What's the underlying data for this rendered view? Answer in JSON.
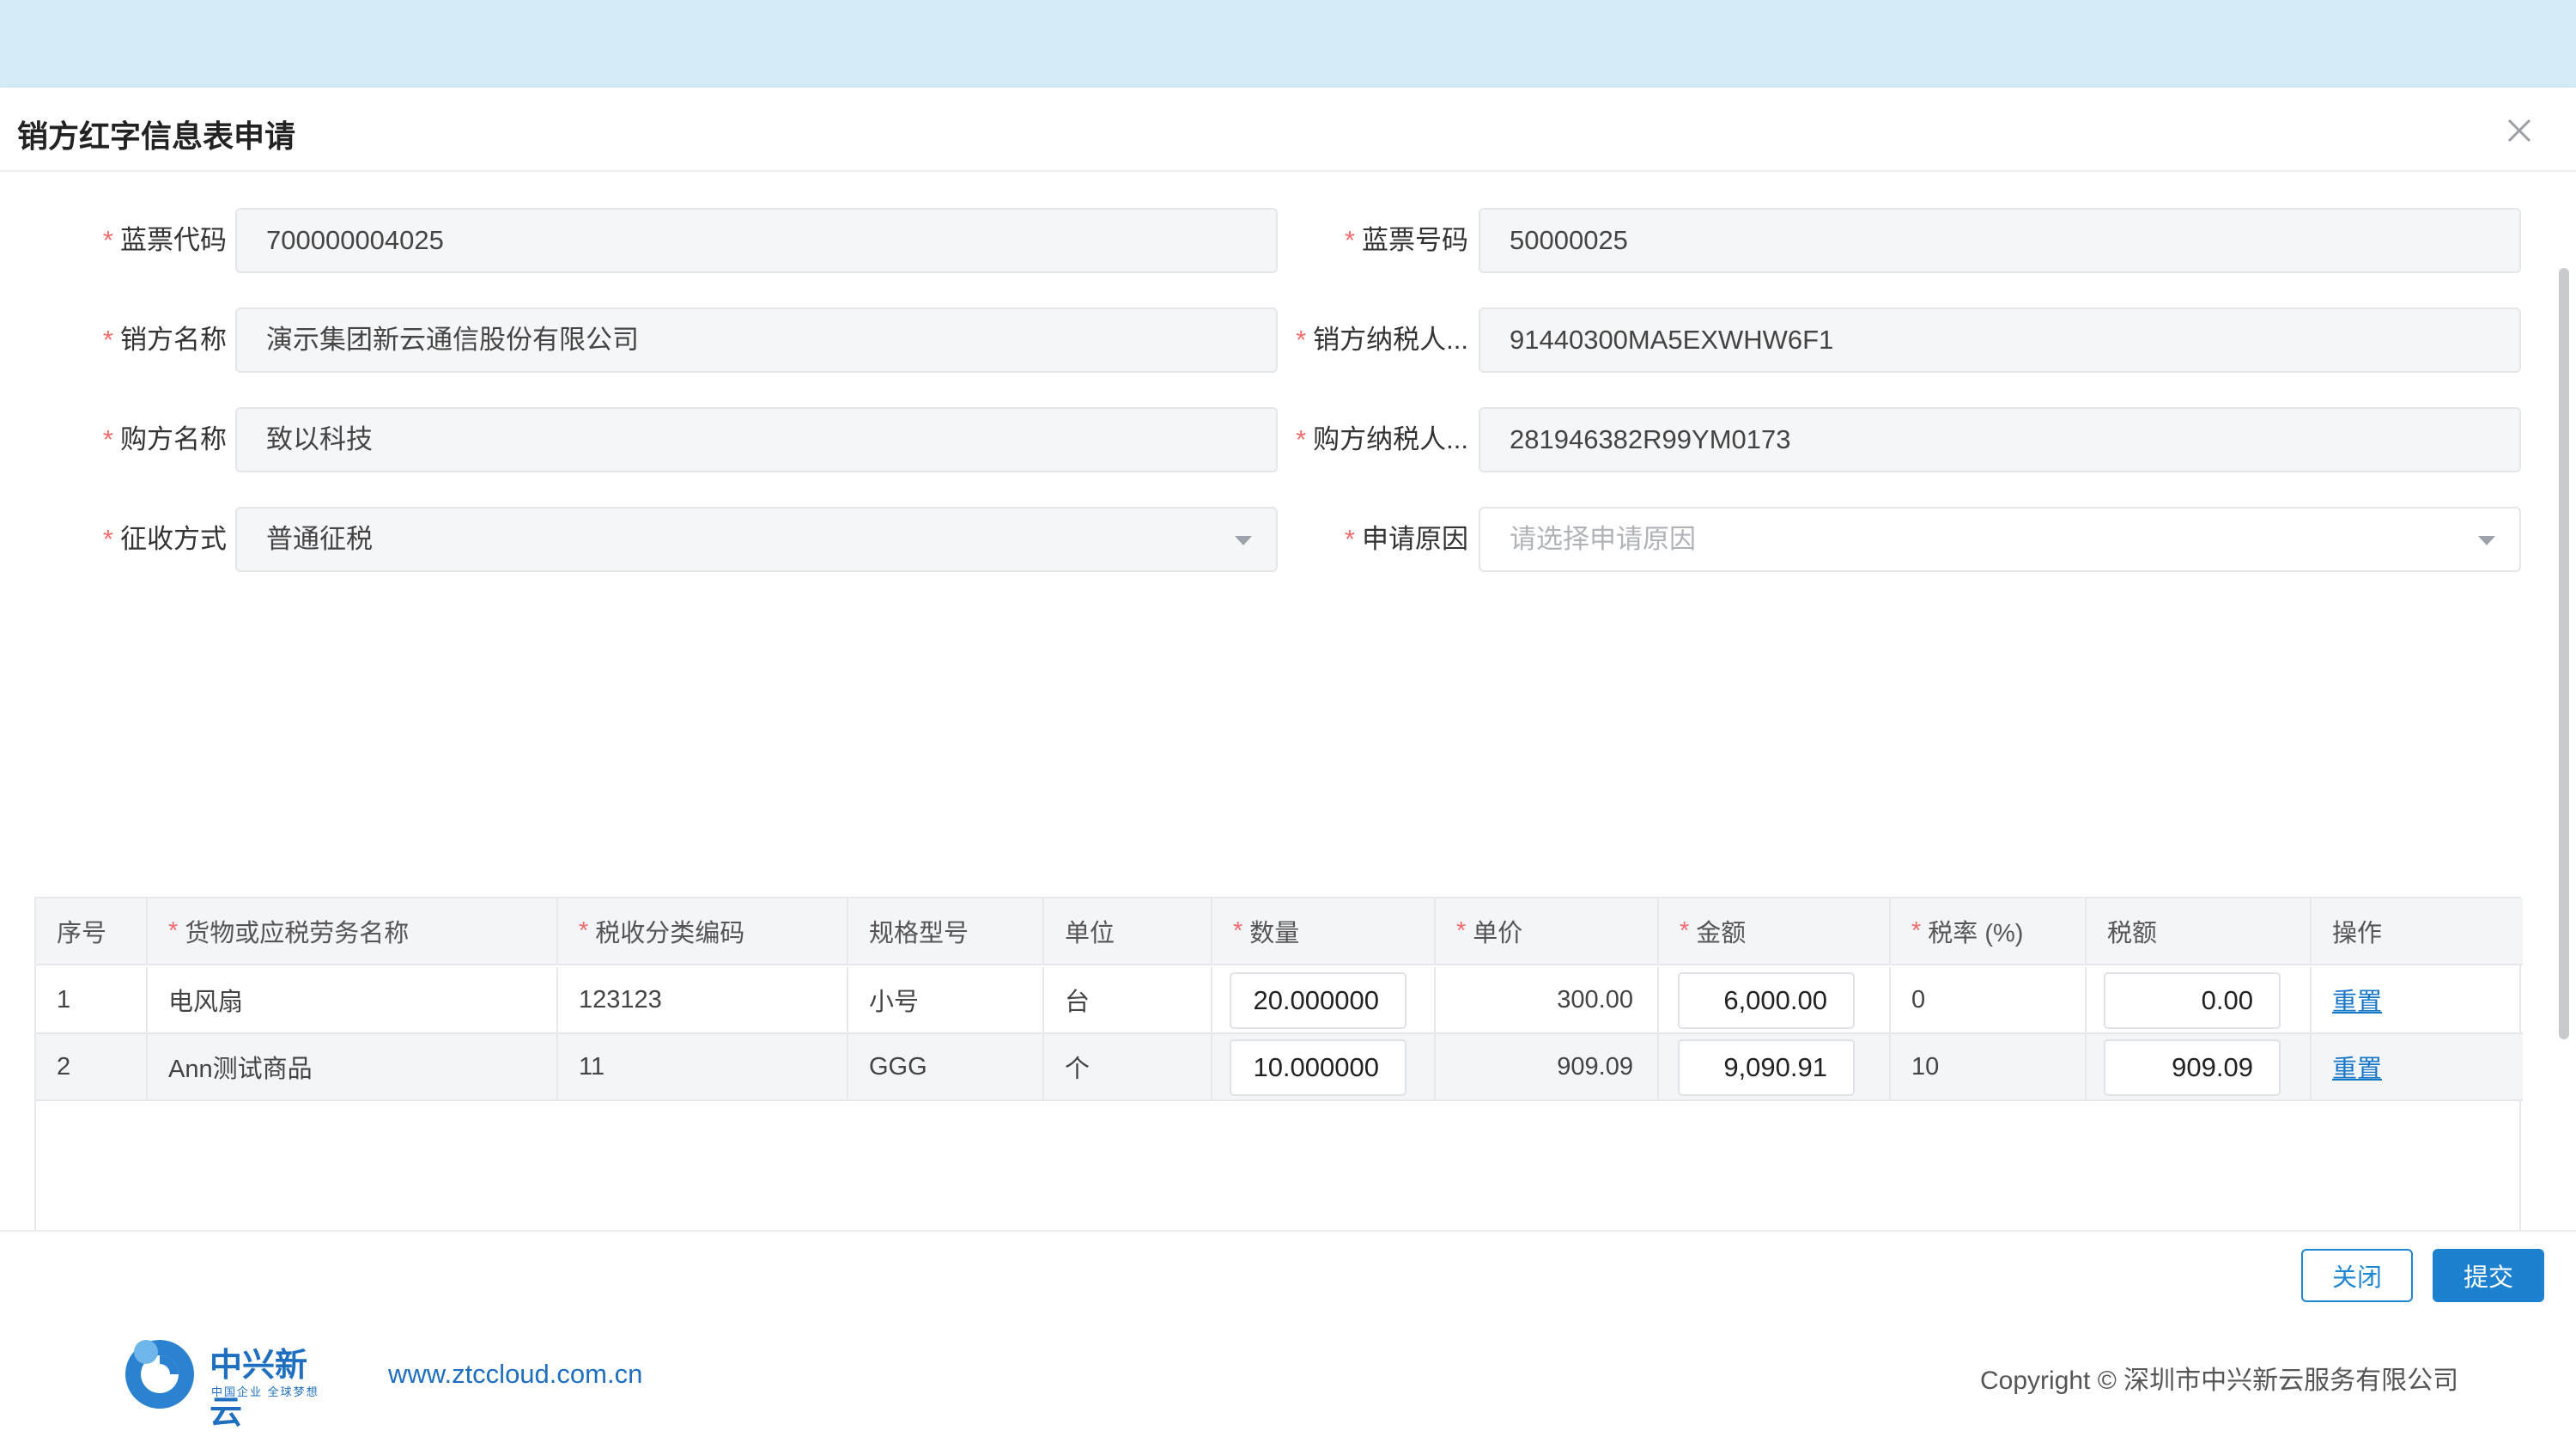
{
  "dialog": {
    "title": "销方红字信息表申请",
    "close_icon": "close-icon"
  },
  "form": {
    "blue_invoice_code_label": "蓝票代码",
    "blue_invoice_code": "700000004025",
    "blue_invoice_number_label": "蓝票号码",
    "blue_invoice_number": "50000025",
    "seller_name_label": "销方名称",
    "seller_name": "演示集团新云通信股份有限公司",
    "seller_tax_id_label": "销方纳税人...",
    "seller_tax_id": "91440300MA5EXWHW6F1",
    "buyer_name_label": "购方名称",
    "buyer_name": "致以科技",
    "buyer_tax_id_label": "购方纳税人...",
    "buyer_tax_id": "281946382R99YM0173",
    "levy_method_label": "征收方式",
    "levy_method": "普通征税",
    "apply_reason_label": "申请原因",
    "apply_reason_placeholder": "请选择申请原因"
  },
  "table": {
    "headers": {
      "index": "序号",
      "goods_name": "货物或应税劳务名称",
      "tax_code": "税收分类编码",
      "spec": "规格型号",
      "unit": "单位",
      "quantity": "数量",
      "unit_price": "单价",
      "amount": "金额",
      "tax_rate": "税率 (%)",
      "tax_amount": "税额",
      "action": "操作"
    },
    "rows": [
      {
        "index": "1",
        "goods_name": "电风扇",
        "tax_code": "123123",
        "spec": "小号",
        "unit": "台",
        "quantity": "20.000000",
        "unit_price": "300.00",
        "amount": "6,000.00",
        "tax_rate": "0",
        "tax_amount": "0.00",
        "action": "重置"
      },
      {
        "index": "2",
        "goods_name": "Ann测试商品",
        "tax_code": "11",
        "spec": "GGG",
        "unit": "个",
        "quantity": "10.000000",
        "unit_price": "909.09",
        "amount": "9,090.91",
        "tax_rate": "10",
        "tax_amount": "909.09",
        "action": "重置"
      }
    ]
  },
  "buttons": {
    "close": "关闭",
    "submit": "提交"
  },
  "footer": {
    "logo_name": "中兴新云",
    "logo_tagline": "中国企业 全球梦想",
    "url": "www.ztccloud.com.cn",
    "copyright": "Copyright © 深圳市中兴新云服务有限公司"
  },
  "colors": {
    "accent": "#1c82cf",
    "required": "#f56c6c",
    "top_band": "#d3ecf6"
  }
}
